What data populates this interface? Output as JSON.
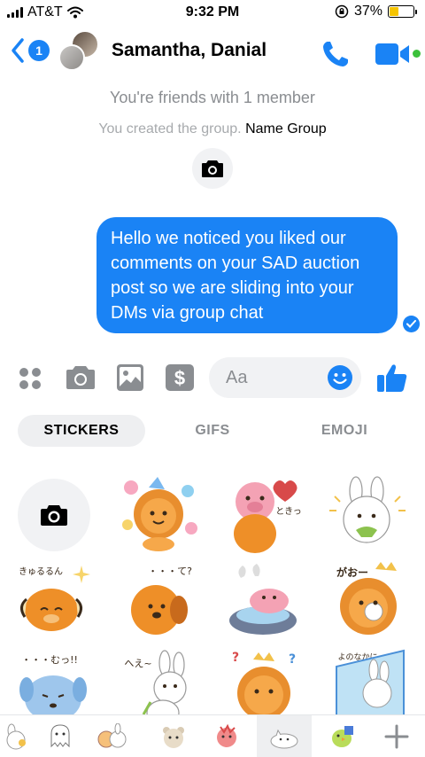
{
  "status_bar": {
    "carrier": "AT&T",
    "time": "9:32 PM",
    "battery": "37%",
    "battery_level": 0.37,
    "icons": [
      "signal-icon",
      "wifi-icon",
      "rotation-lock-icon",
      "battery-icon"
    ]
  },
  "header": {
    "back_count": "1",
    "title": "Samantha, Danial",
    "icons": [
      "back-chevron-icon",
      "phone-icon",
      "video-camera-icon"
    ]
  },
  "conversation": {
    "friends_info": "You're friends with 1 member",
    "created_text": "You created the group.",
    "name_group_link": "Name Group",
    "message": "Hello we noticed you liked our comments on your SAD auction post so we are sliding into your DMs via group chat"
  },
  "composer": {
    "placeholder": "Aa",
    "icons": [
      "more-dots-icon",
      "camera-icon",
      "gallery-icon",
      "dollar-icon",
      "smiley-icon",
      "thumbs-up-icon"
    ]
  },
  "tabs": [
    {
      "label": "STICKERS"
    },
    {
      "label": "GIFS"
    },
    {
      "label": "EMOJI"
    }
  ],
  "stickers": [
    "camera-icon",
    "party-lion-sticker",
    "pig-heart-sticker",
    "bunny-cheering-sticker",
    "cow-sparkle-sticker",
    "puppy-question-sticker",
    "pig-bath-sticker",
    "lion-hug-sticker",
    "blue-dog-sticker",
    "bunny-walking-sticker",
    "lion-confused-sticker",
    "bunny-waterfall-sticker"
  ],
  "sticker_text": {
    "kyurun": "きゅるるん",
    "tokki": "ときっ",
    "te": "・・・て?",
    "gao": "がおー",
    "mutt": "・・・むっ!!",
    "hee": "へえ~",
    "yonona": "よのなかに"
  },
  "packs": [
    "bunny-pack-icon",
    "ghost-pack-icon",
    "bunnies-pack-icon",
    "bear-pack-icon",
    "chick-pack-icon",
    "cat-pack-icon",
    "bird-pack-icon",
    "add-pack-icon"
  ],
  "colors": {
    "accent": "#1a83f5",
    "online": "#3cc13b",
    "battery": "#f5c400",
    "muted_text": "#8a8d91"
  }
}
